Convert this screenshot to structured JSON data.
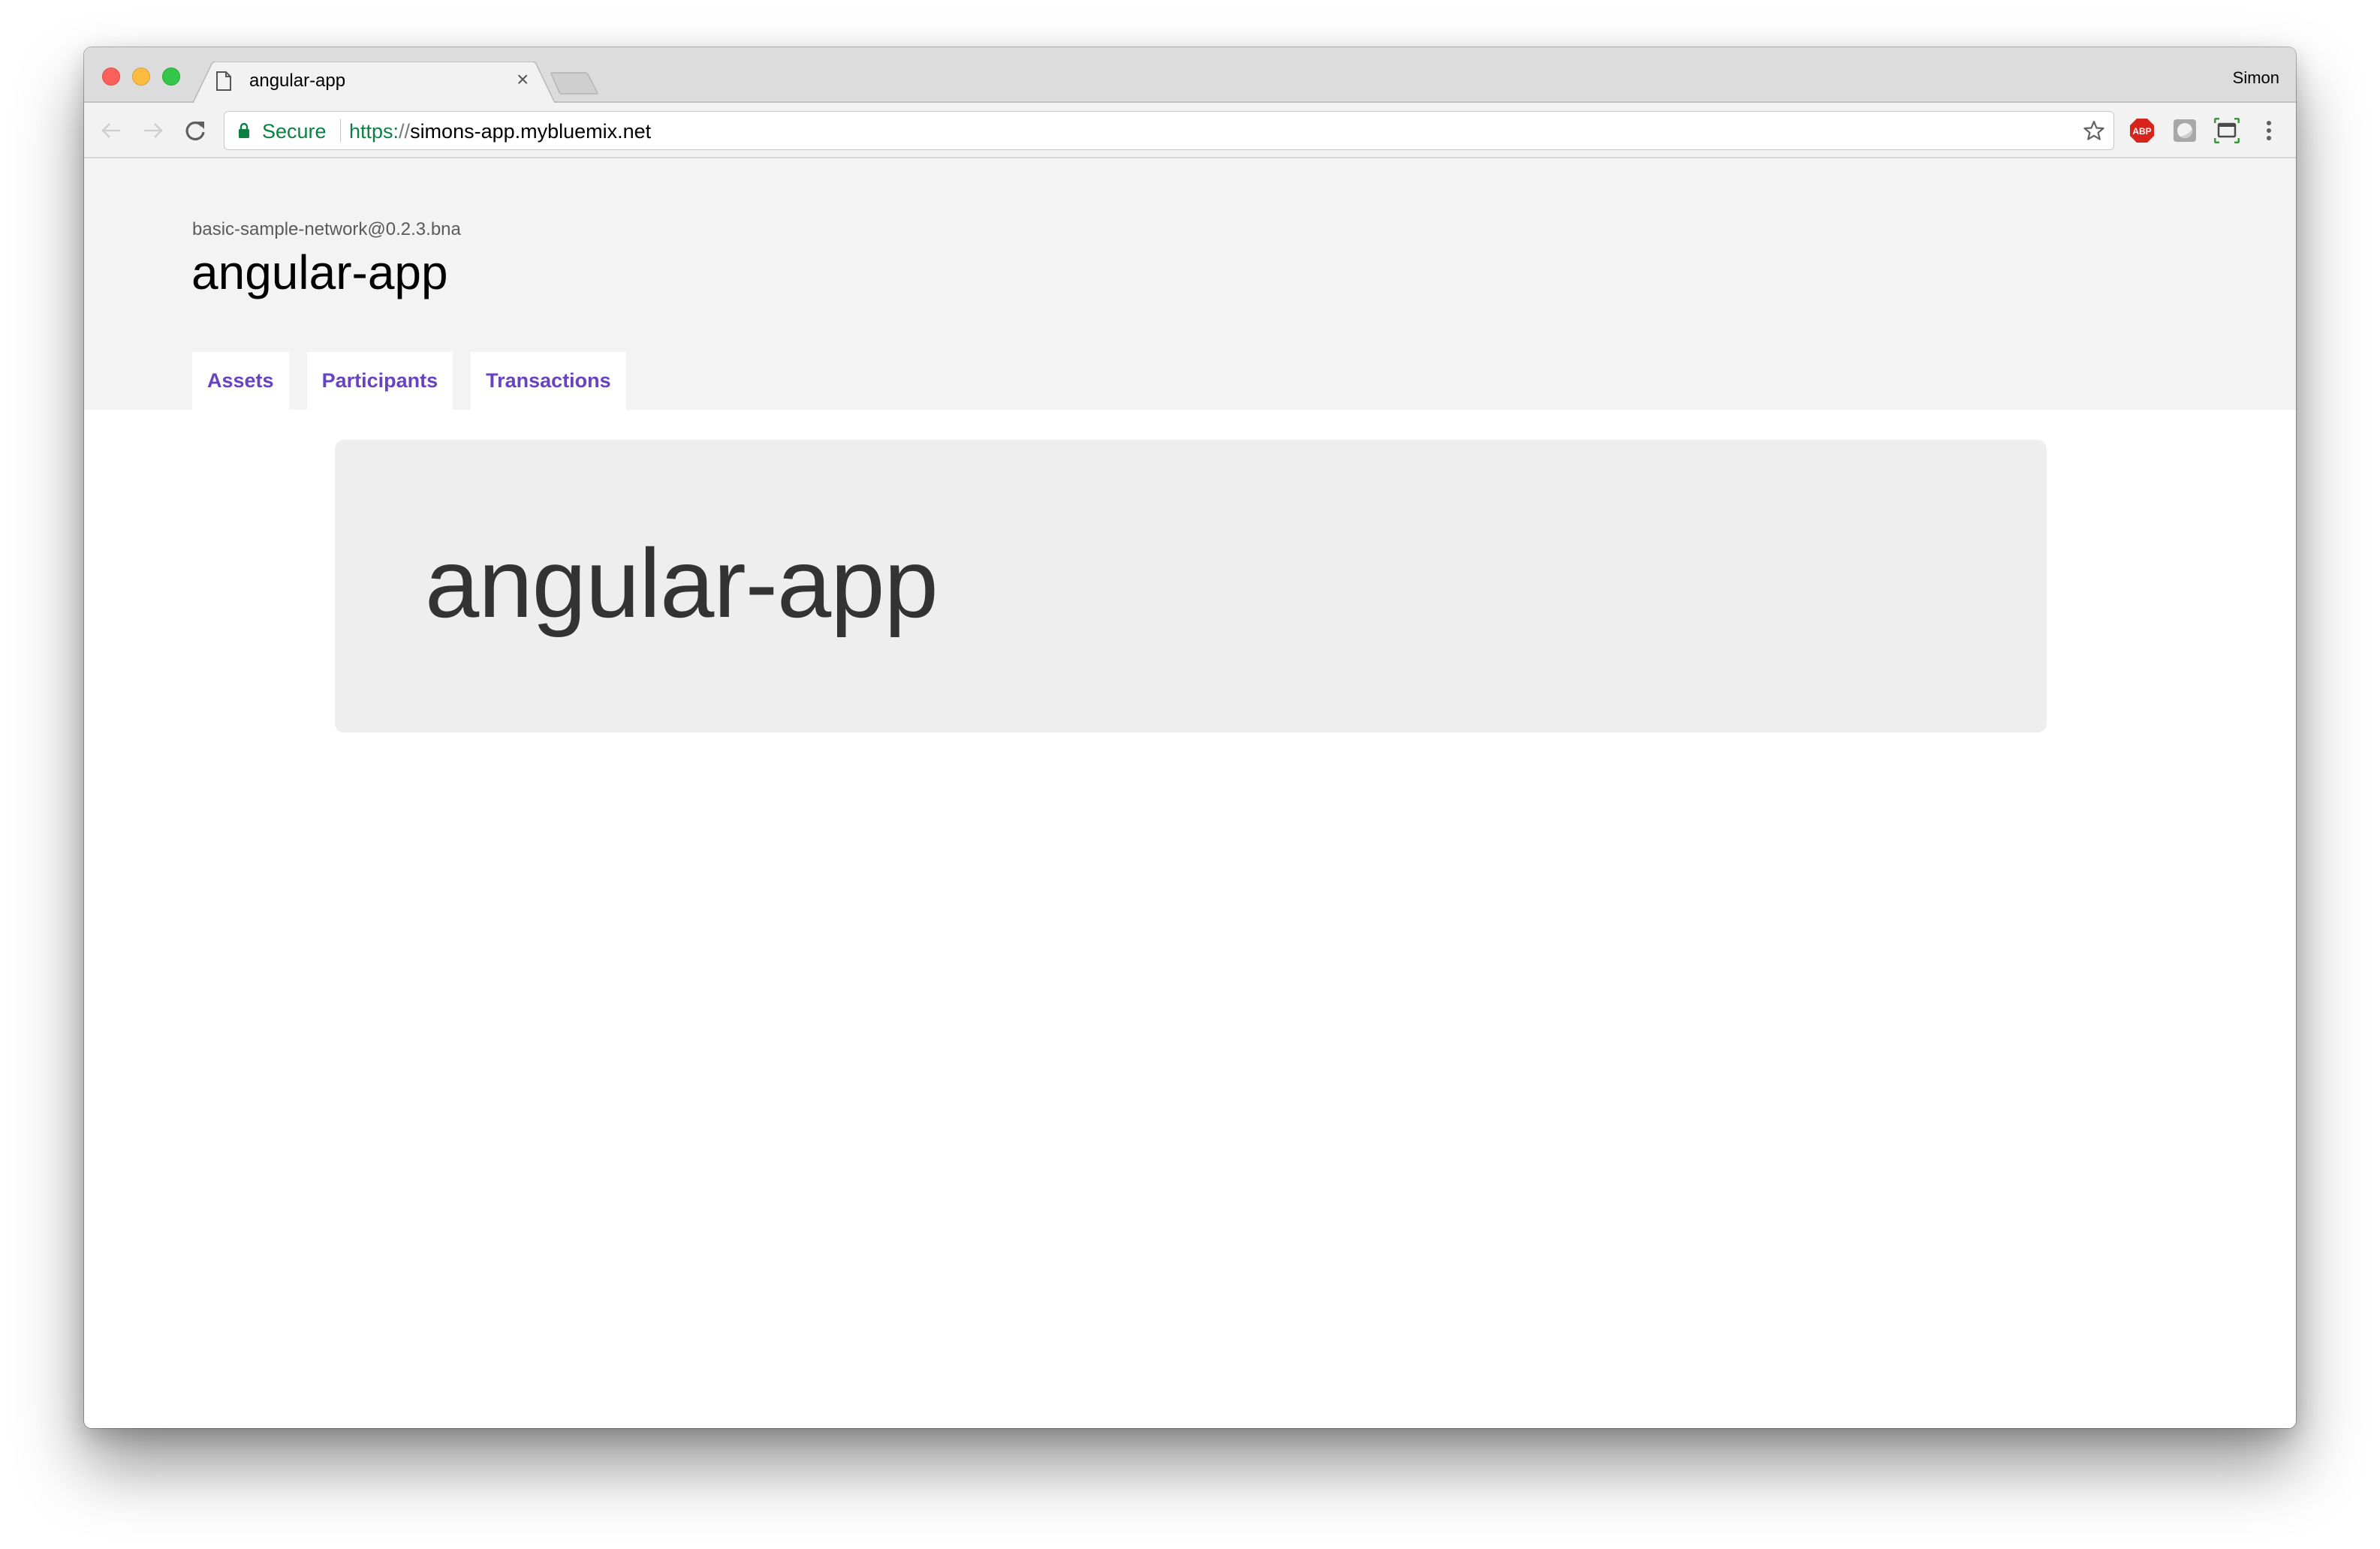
{
  "browser": {
    "tab": {
      "title": "angular-app",
      "icon": "file-icon",
      "close_glyph": "×"
    },
    "profile_name": "Simon",
    "address_bar": {
      "security_label": "Secure",
      "url_scheme": "https:",
      "url_slashes": "//",
      "url_host": "simons-app.mybluemix.net"
    },
    "extensions": [
      {
        "name": "adblock-plus",
        "label": "ABP",
        "color": "#d6241c"
      },
      {
        "name": "grey-extension"
      },
      {
        "name": "screen-capture"
      }
    ],
    "colors": {
      "secure_green": "#0b8043"
    }
  },
  "app": {
    "subtitle": "basic-sample-network@0.2.3.bna",
    "title": "angular-app",
    "nav_tabs": [
      {
        "label": "Assets"
      },
      {
        "label": "Participants"
      },
      {
        "label": "Transactions"
      }
    ],
    "jumbotron_heading": "angular-app",
    "colors": {
      "tab_text": "#6743c0",
      "header_bg": "#f3f3f3",
      "jumbotron_bg": "#eeeeee"
    }
  }
}
